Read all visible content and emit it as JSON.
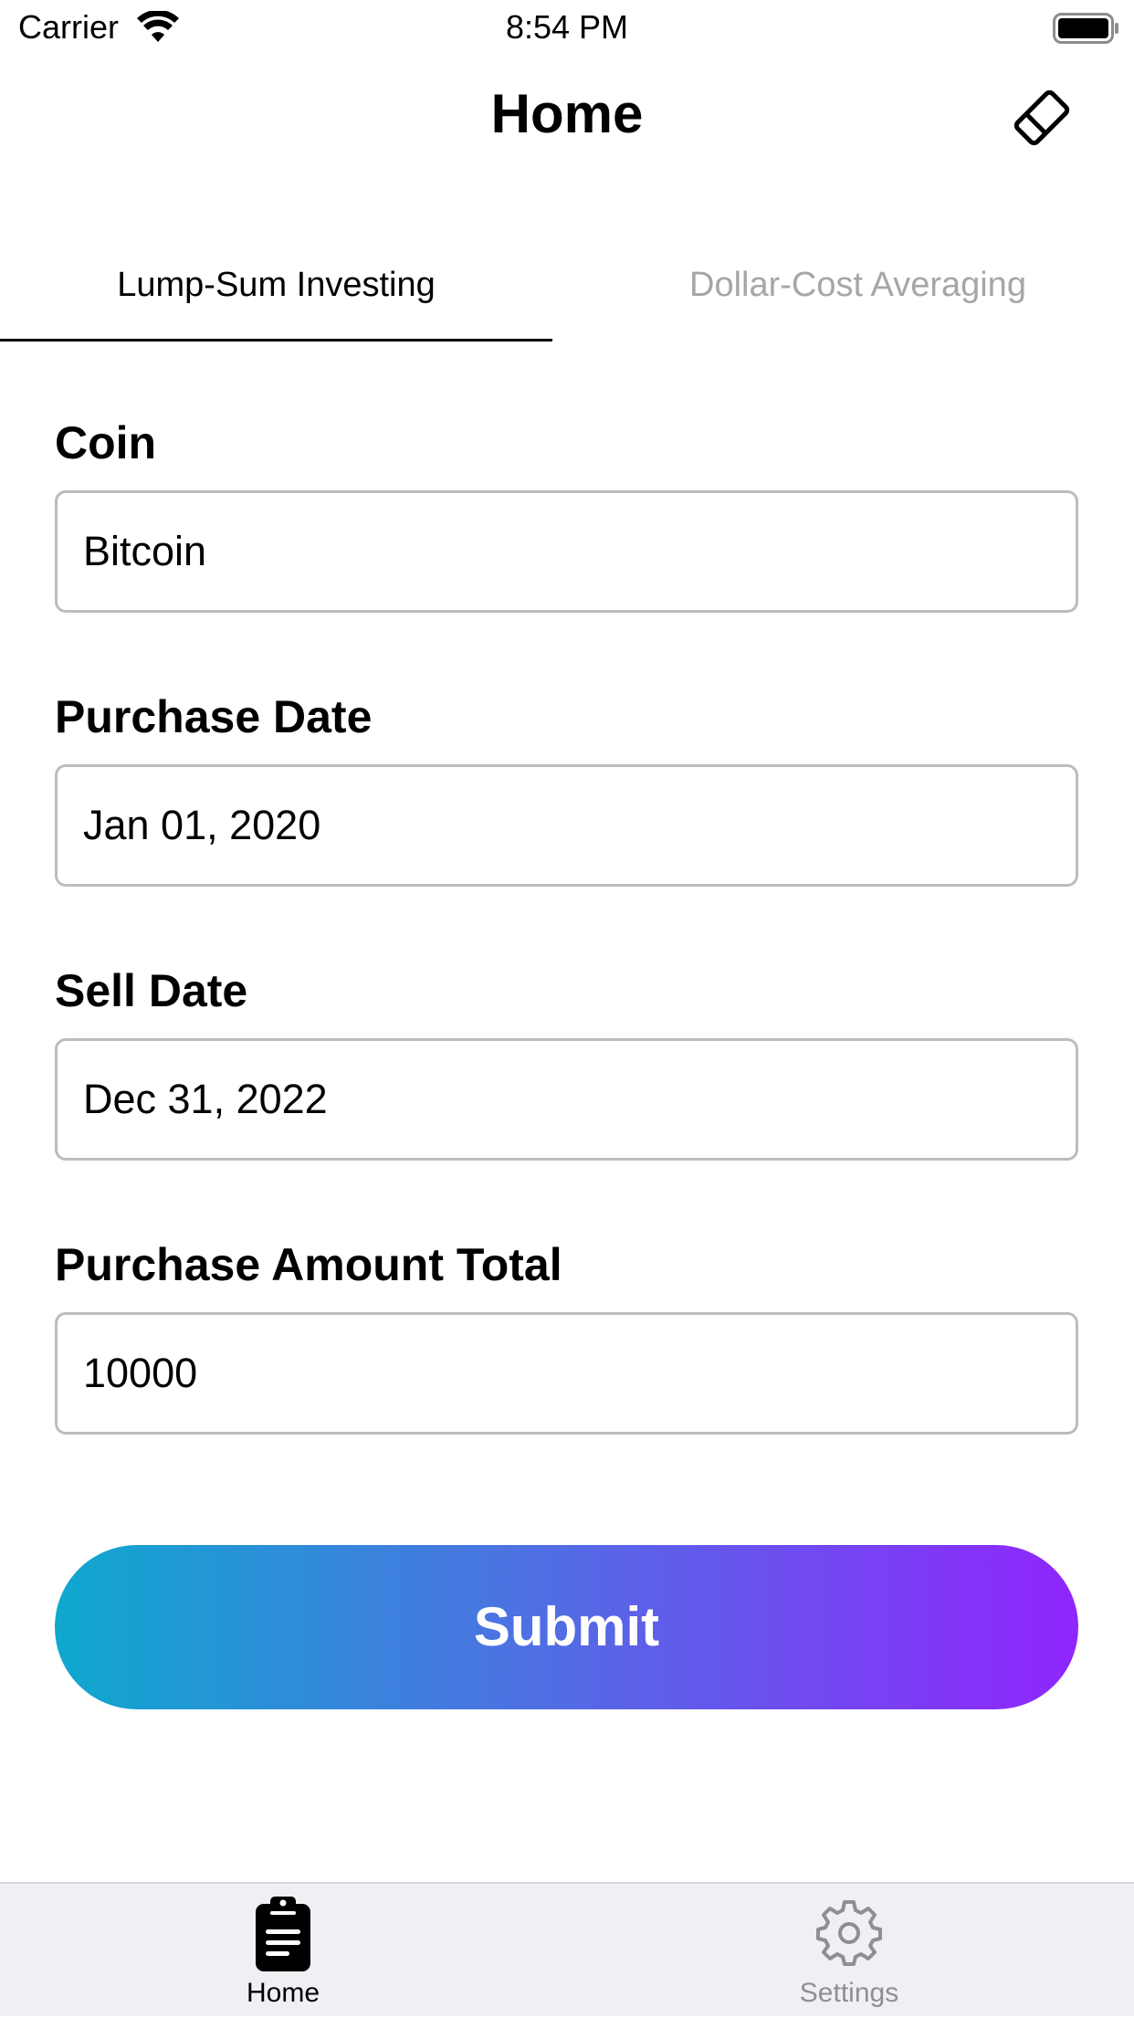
{
  "status_bar": {
    "carrier": "Carrier",
    "time": "8:54 PM",
    "wifi_icon": "wifi-icon",
    "battery_icon": "battery-icon"
  },
  "nav": {
    "title": "Home",
    "right_icon": "eraser-icon"
  },
  "segments": {
    "items": [
      {
        "label": "Lump-Sum Investing",
        "selected": true
      },
      {
        "label": "Dollar-Cost Averaging",
        "selected": false
      }
    ]
  },
  "form": {
    "coin": {
      "label": "Coin",
      "value": "Bitcoin"
    },
    "purchase_date": {
      "label": "Purchase Date",
      "value": "Jan 01, 2020"
    },
    "sell_date": {
      "label": "Sell Date",
      "value": "Dec 31, 2022"
    },
    "purchase_amount": {
      "label": "Purchase Amount Total",
      "value": "10000"
    },
    "submit_label": "Submit"
  },
  "colors": {
    "gradient_start": "#0ea8ce",
    "gradient_end": "#9025fd",
    "inactive": "#8e8e93",
    "border": "#bcbcc0",
    "tab_bar_bg": "#efeff4"
  },
  "tab_bar": {
    "items": [
      {
        "label": "Home",
        "icon": "clipboard-icon",
        "active": true
      },
      {
        "label": "Settings",
        "icon": "gear-icon",
        "active": false
      }
    ]
  }
}
